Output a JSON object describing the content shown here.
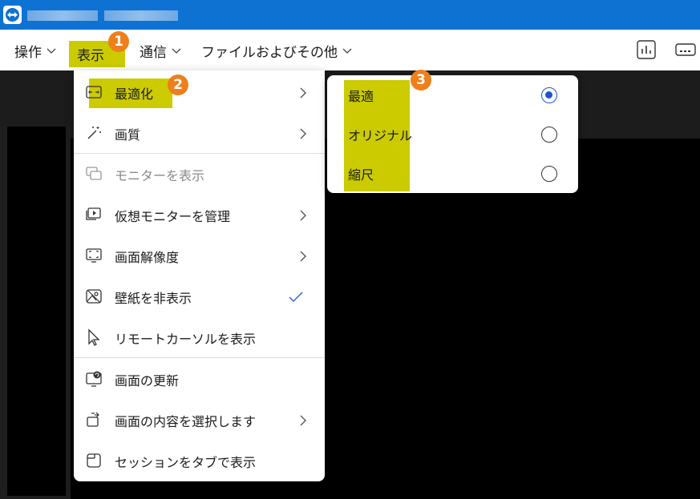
{
  "titlebar": {
    "logo_icon": "teamviewer-logo-icon"
  },
  "menubar": {
    "items": [
      {
        "label": "操作"
      },
      {
        "label": "表示"
      },
      {
        "label": "通信"
      },
      {
        "label": "ファイルおよびその他"
      }
    ],
    "toolbar_icons": [
      "stats-chart-icon",
      "remote-keyboard-icon"
    ]
  },
  "badges": [
    "1",
    "2",
    "3"
  ],
  "view_menu": {
    "items": [
      {
        "label": "最適化",
        "icon": "fit-screen-icon",
        "submenu": true
      },
      {
        "label": "画質",
        "icon": "magic-wand-icon",
        "submenu": true
      },
      {
        "label": "モニターを表示",
        "icon": "monitors-icon",
        "disabled": true
      },
      {
        "label": "仮想モニターを管理",
        "icon": "virtual-monitor-icon",
        "submenu": true
      },
      {
        "label": "画面解像度",
        "icon": "screen-resolution-icon",
        "submenu": true
      },
      {
        "label": "壁紙を非表示",
        "icon": "wallpaper-icon",
        "checked": true
      },
      {
        "label": "リモートカーソルを表示",
        "icon": "cursor-icon"
      },
      {
        "label": "画面の更新",
        "icon": "refresh-screen-icon"
      },
      {
        "label": "画面の内容を選択します",
        "icon": "select-content-icon",
        "submenu": true
      },
      {
        "label": "セッションをタブで表示",
        "icon": "tab-icon"
      }
    ]
  },
  "fit_submenu": {
    "options": [
      {
        "label": "最適",
        "selected": true
      },
      {
        "label": "オリジナル",
        "selected": false
      },
      {
        "label": "縮尺",
        "selected": false
      }
    ]
  },
  "colors": {
    "titlebar": "#0e72d3",
    "highlight": "#cbcb00",
    "badge": "#ef7f1a",
    "radio_selected": "#1a56c9"
  }
}
